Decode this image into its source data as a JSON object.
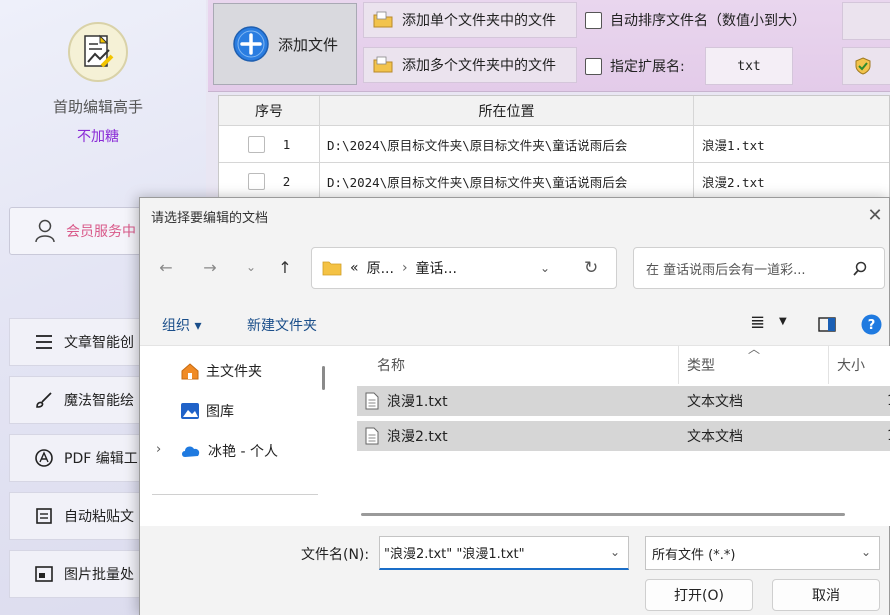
{
  "app": {
    "name": "首助编辑高手",
    "subtitle": "不加糖",
    "member_label": "会员服务中",
    "menu": [
      {
        "label": "文章智能创",
        "icon": "list-icon"
      },
      {
        "label": "魔法智能绘",
        "icon": "brush-icon"
      },
      {
        "label": "PDF 编辑工",
        "icon": "pdf-icon"
      },
      {
        "label": "自动粘贴文",
        "icon": "paste-icon"
      },
      {
        "label": "图片批量处",
        "icon": "image-icon"
      }
    ]
  },
  "toolbar": {
    "add_file": "添加文件",
    "add_single_folder": "添加单个文件夹中的文件",
    "add_multi_folder": "添加多个文件夹中的文件",
    "auto_sort": "自动排序文件名（数值小到大）",
    "ext_label": "指定扩展名:",
    "ext_value": "txt"
  },
  "table": {
    "headers": [
      "序号",
      "所在位置",
      ""
    ],
    "rows": [
      {
        "num": "1",
        "path": "D:\\2024\\原目标文件夹\\原目标文件夹\\童话说雨后会",
        "name": "浪漫1.txt"
      },
      {
        "num": "2",
        "path": "D:\\2024\\原目标文件夹\\原目标文件夹\\童话说雨后会",
        "name": "浪漫2.txt"
      }
    ]
  },
  "dialog": {
    "title": "请选择要编辑的文档",
    "address": {
      "prefix": "«",
      "seg1": "原...",
      "sep": "›",
      "seg2": "童话..."
    },
    "search_placeholder": "在 童话说雨后会有一道彩...",
    "organize": "组织 ▾",
    "new_folder": "新建文件夹",
    "nav": [
      {
        "label": "主文件夹",
        "icon": "home-icon"
      },
      {
        "label": "图库",
        "icon": "gallery-icon"
      },
      {
        "label": "冰艳 - 个人",
        "icon": "cloud-icon"
      }
    ],
    "columns": {
      "name": "名称",
      "type": "类型",
      "size": "大小"
    },
    "files": [
      {
        "name": "浪漫1.txt",
        "type": "文本文档",
        "size": "1"
      },
      {
        "name": "浪漫2.txt",
        "type": "文本文档",
        "size": "1"
      }
    ],
    "filename_label": "文件名(N):",
    "filename_value": "\"浪漫2.txt\" \"浪漫1.txt\"",
    "filetype": "所有文件 (*.*)",
    "open": "打开(O)",
    "cancel": "取消"
  }
}
